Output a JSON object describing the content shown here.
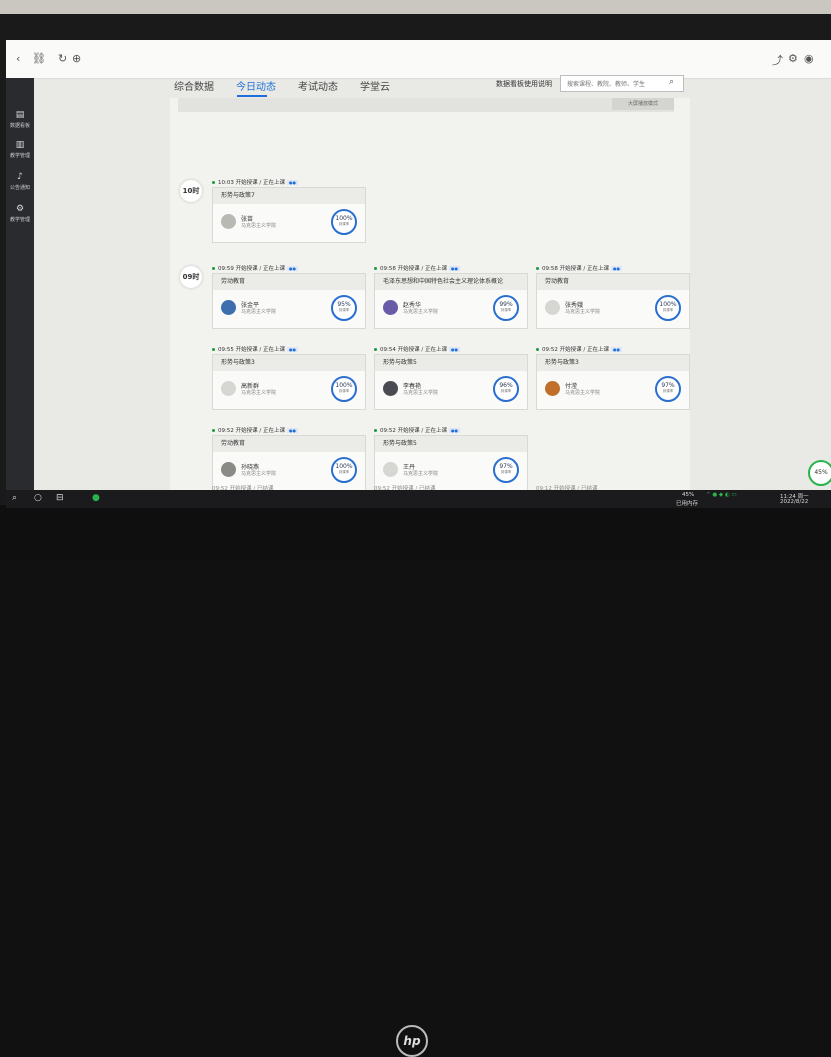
{
  "tabs": [
    {
      "label": "综合数据",
      "active": false
    },
    {
      "label": "今日动态",
      "active": true
    },
    {
      "label": "考试动态",
      "active": false
    },
    {
      "label": "学堂云",
      "active": false
    }
  ],
  "help_link": "数据看板使用说明",
  "search": {
    "placeholder": "搜索课程、教院、教师、学生"
  },
  "sidebar": [
    {
      "icon": "chart-icon",
      "label": "数据看板"
    },
    {
      "icon": "book-icon",
      "label": "教学管理"
    },
    {
      "icon": "bell-icon",
      "label": "公告通知"
    },
    {
      "icon": "gear-icon",
      "label": "教学管理"
    }
  ],
  "prev_button": "大屏播放模式",
  "hours": [
    "10时",
    "09时"
  ],
  "cards": [
    {
      "time": "10:03 开始授课 / 正在上课",
      "title": "形势与政策7",
      "teacher": "张苗",
      "dept": "马克思主义学院",
      "rate": "100%",
      "rate_label": "到课率"
    },
    {
      "time": "09:59 开始授课 / 正在上课",
      "title": "劳动教育",
      "teacher": "张金平",
      "dept": "马克思主义学院",
      "rate": "95%",
      "rate_label": "到课率"
    },
    {
      "time": "09:58 开始授课 / 正在上课",
      "title": "毛泽东思想和中国特色社会主义理论体系概论",
      "teacher": "赵秀华",
      "dept": "马克思主义学院",
      "rate": "99%",
      "rate_label": "到课率"
    },
    {
      "time": "09:58 开始授课 / 正在上课",
      "title": "劳动教育",
      "teacher": "张秀娥",
      "dept": "马克思主义学院",
      "rate": "100%",
      "rate_label": "到课率"
    },
    {
      "time": "09:55 开始授课 / 正在上课",
      "title": "形势与政策3",
      "teacher": "高新群",
      "dept": "马克思主义学院",
      "rate": "100%",
      "rate_label": "到课率"
    },
    {
      "time": "09:54 开始授课 / 正在上课",
      "title": "形势与政策5",
      "teacher": "李春艳",
      "dept": "马克思主义学院",
      "rate": "96%",
      "rate_label": "到课率"
    },
    {
      "time": "09:52 开始授课 / 正在上课",
      "title": "形势与政策3",
      "teacher": "付滢",
      "dept": "马克思主义学院",
      "rate": "97%",
      "rate_label": "到课率"
    },
    {
      "time": "09:52 开始授课 / 正在上课",
      "title": "劳动教育",
      "teacher": "孙晓燕",
      "dept": "马克思主义学院",
      "rate": "100%",
      "rate_label": "到课率"
    },
    {
      "time": "09:52 开始授课 / 正在上课",
      "title": "形势与政策5",
      "teacher": "王丹",
      "dept": "马克思主义学院",
      "rate": "97%",
      "rate_label": "到课率"
    }
  ],
  "faded_rows": [
    "09:52 开始授课 / 已结课",
    "09:52 开始授课 / 已结课",
    "09:12 开始授课 / 已结课"
  ],
  "taskbar": {
    "memory_pct": "45%",
    "memory_label": "已用内存",
    "time": "11:24 周一",
    "date": "2022/8/22"
  },
  "float_widget": "45%",
  "brand": "hp",
  "colors": {
    "accent": "#1e6fd9",
    "live": "#1a9b3c"
  }
}
